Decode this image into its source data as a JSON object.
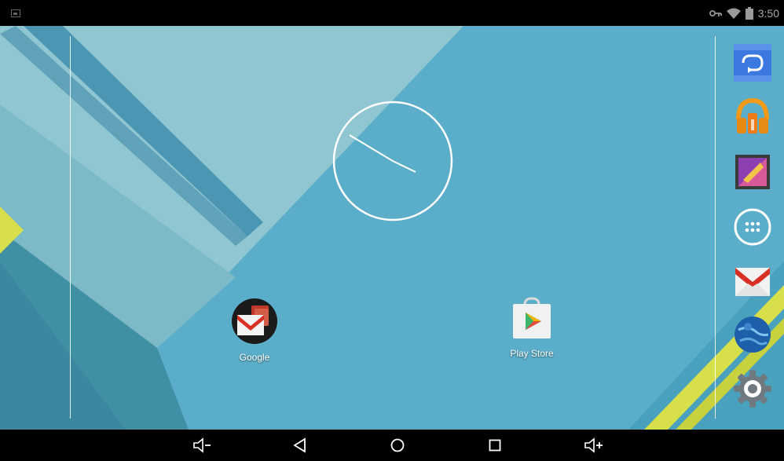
{
  "status_bar": {
    "time": "3:50",
    "icons": [
      "screenshot-icon",
      "vpn-key-icon",
      "wifi-icon",
      "battery-icon"
    ]
  },
  "clock": {
    "type": "analog",
    "hour_hand_angle_deg": 300,
    "minute_hand_angle_deg": 300
  },
  "desktop_icons": [
    {
      "label": "Google",
      "icon": "gmail-folder-icon"
    },
    {
      "label": "Play Store",
      "icon": "play-store-icon"
    }
  ],
  "dock": {
    "items": [
      "photo-sync-app-icon",
      "play-music-icon",
      "gallery-icon",
      "app-drawer-icon",
      "gmail-icon",
      "browser-globe-icon",
      "settings-gear-icon"
    ]
  },
  "nav_bar": {
    "buttons": [
      "volume-down-icon",
      "back-icon",
      "home-icon",
      "recents-icon",
      "volume-up-icon"
    ]
  },
  "colors": {
    "wallpaper_main": "#5aaec9",
    "wallpaper_light": "#8fc6d1",
    "wallpaper_dark": "#3f8fa5",
    "stripe": "#4b96b3",
    "yellow": "#d7e04a"
  }
}
